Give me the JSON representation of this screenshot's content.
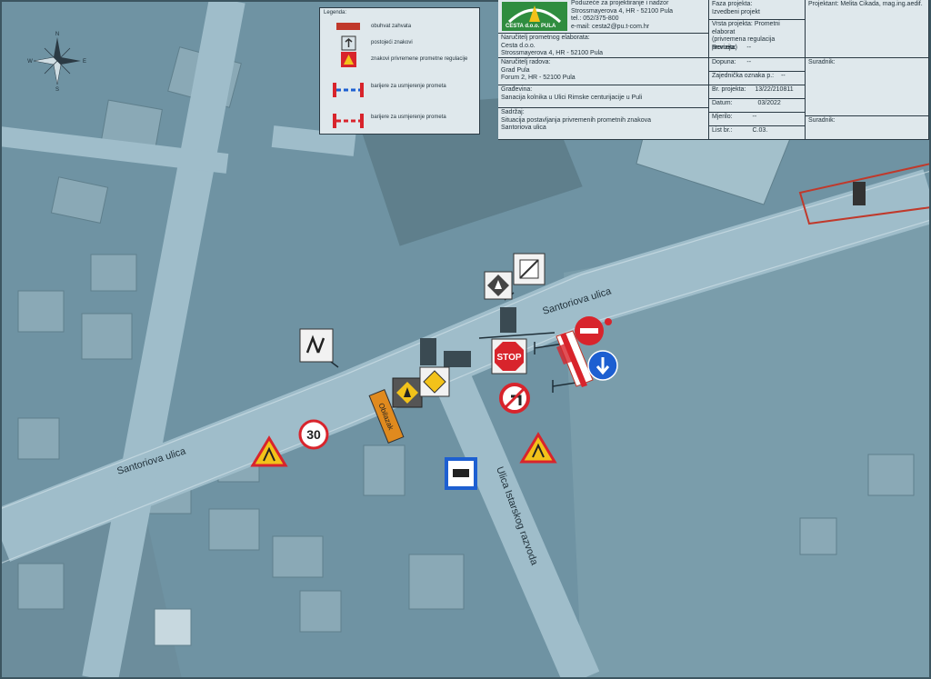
{
  "legend": {
    "title": "Legenda:",
    "items": [
      {
        "label": "obuhvat zahvata"
      },
      {
        "label": "postojeći znakovi"
      },
      {
        "label": "znakovi privremene prometne regulacije"
      },
      {
        "label": "barijere za usmjerenje prometa"
      },
      {
        "label": "barijere za usmjerenje prometa"
      }
    ]
  },
  "title_block": {
    "company": {
      "logo_text": "CESTA d.o.o. PULA",
      "line1": "Poduzeće za projektiranje i nadzor",
      "line2": "Strossmayerova 4, HR - 52100 Pula",
      "line3": "tel.: 052/375-800",
      "line4": "e-mail: cesta2@pu.t-com.hr"
    },
    "faza": {
      "label": "Faza projekta:",
      "value": "Izvedbeni projekt"
    },
    "projektant": "Projektant: Melita Cikada, mag.ing.aedif.",
    "vrsta": {
      "label": "Vrsta projekta:",
      "value": "Prometni elaborat",
      "value2": "(privremena regulacija prometa)"
    },
    "narucitelj_elaborata": {
      "label": "Naručitelj prometnog elaborata:",
      "line1": "Cesta d.o.o.",
      "line2": "Strossmayerova 4, HR - 52100 Pula"
    },
    "revizija": {
      "label": "Revizija:",
      "value": "--"
    },
    "narucitelj_radova": {
      "label": "Naručitelj radova:",
      "line1": "Grad Pula",
      "line2": "Forum 2, HR - 52100 Pula"
    },
    "dopuna": {
      "label": "Dopuna:",
      "value": "--"
    },
    "suradnik1": "Suradnik:",
    "zajednicka": {
      "label": "Zajednička oznaka p.:",
      "value": "--"
    },
    "gradjevina": {
      "label": "Građevina:",
      "value": "Sanacija kolnika u Ulici Rimske centurijacije u Puli"
    },
    "br_projekta": {
      "label": "Br. projekta:",
      "value": "13/22/210811"
    },
    "datum": {
      "label": "Datum:",
      "value": "03/2022"
    },
    "sadrzaj": {
      "label": "Sadržaj:",
      "line1": "Situacija postavljanja privremenih prometnih znakova",
      "line2": "Santoriova ulica"
    },
    "mjerilo": {
      "label": "Mjerilo:",
      "value": "--"
    },
    "suradnik2": "Suradnik:",
    "list": {
      "label": "List br.:",
      "value": "C.03."
    }
  },
  "map": {
    "compass": {
      "n": "N",
      "w": "W",
      "e": "E",
      "s": "S"
    },
    "street_labels": {
      "santoriova_upper": "Santoriova ulica",
      "santoriova_lower": "Santoriova ulica",
      "istarskog": "Ulica Istarskog razvoda"
    },
    "signs": {
      "stop": "STOP",
      "speed_limit": "30",
      "detour": "Obilazak"
    }
  },
  "colors": {
    "overlay": "#6f93a3",
    "road": "#9fbdca",
    "building": "#8aa9b6",
    "work_zone": "#c0392b",
    "warning_yellow": "#f2c21a",
    "sign_blue": "#1d5fd1",
    "sign_red": "#d8242c"
  }
}
